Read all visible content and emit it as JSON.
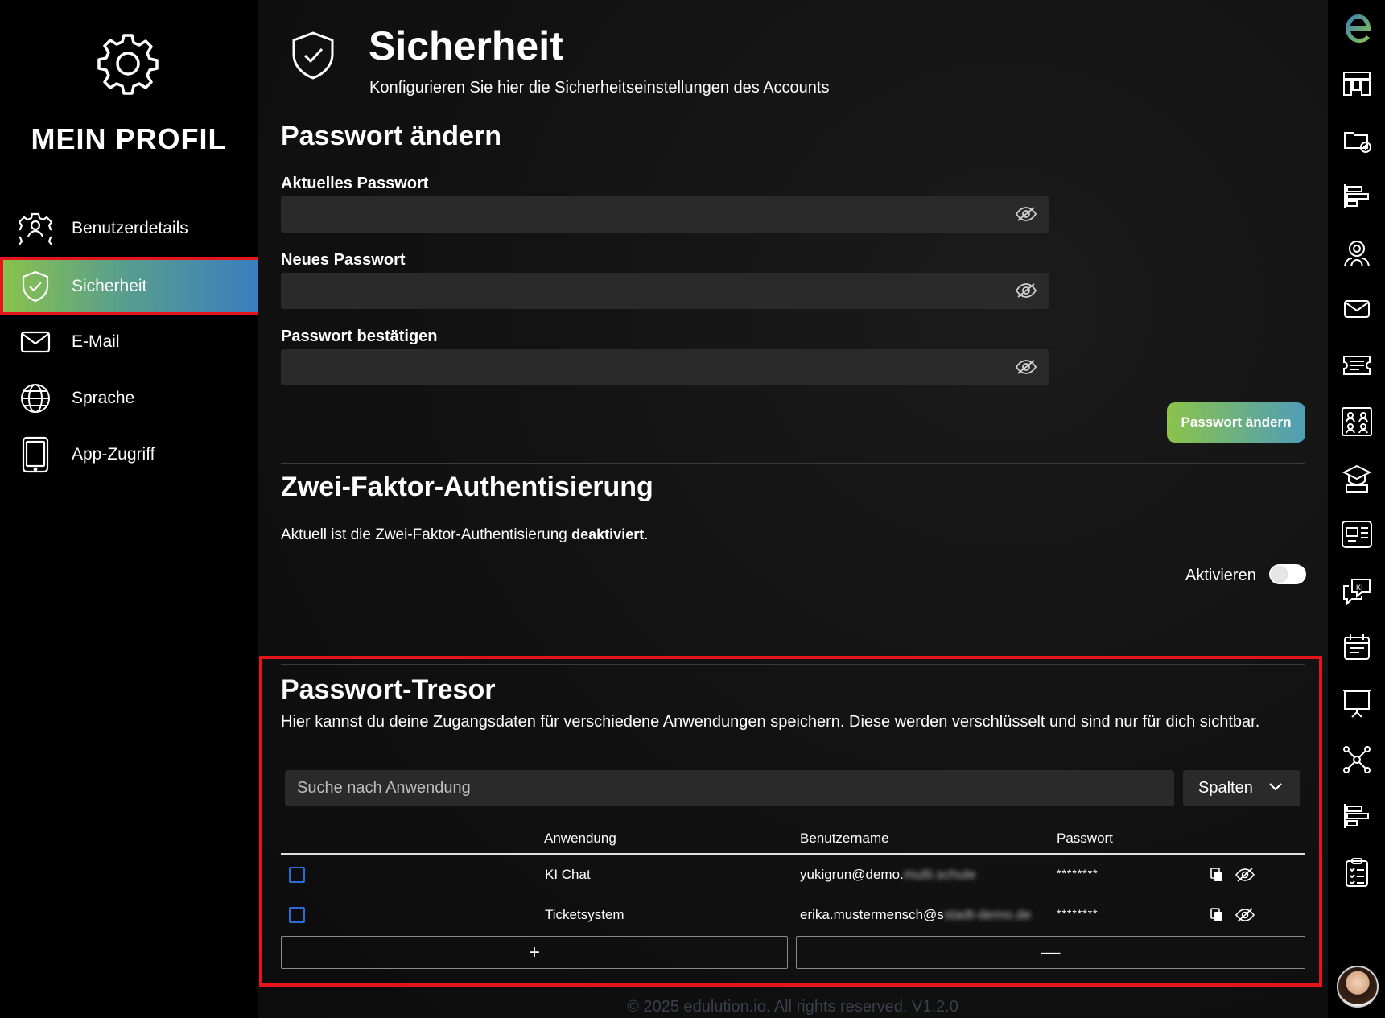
{
  "sidebar": {
    "title": "MEIN PROFIL",
    "items": [
      {
        "label": "Benutzerdetails",
        "icon": "user-gear-icon",
        "active": false
      },
      {
        "label": "Sicherheit",
        "icon": "shield-check-icon",
        "active": true
      },
      {
        "label": "E-Mail",
        "icon": "mail-icon",
        "active": false
      },
      {
        "label": "Sprache",
        "icon": "globe-icon",
        "active": false
      },
      {
        "label": "App-Zugriff",
        "icon": "tablet-icon",
        "active": false
      }
    ]
  },
  "header": {
    "title": "Sicherheit",
    "subtitle": "Konfigurieren Sie hier die Sicherheitseinstellungen des Accounts"
  },
  "password_change": {
    "heading": "Passwort ändern",
    "current_label": "Aktuelles Passwort",
    "new_label": "Neues Passwort",
    "confirm_label": "Passwort bestätigen",
    "submit_label": "Passwort ändern"
  },
  "two_factor": {
    "heading": "Zwei-Faktor-Authentisierung",
    "status_prefix": "Aktuell ist die Zwei-Faktor-Authentisierung",
    "status_value": "deaktiviert",
    "status_suffix": ".",
    "toggle_label": "Aktivieren",
    "enabled": false
  },
  "vault": {
    "heading": "Passwort-Tresor",
    "description": "Hier kannst du deine Zugangsdaten für verschiedene Anwendungen speichern. Diese werden verschlüsselt und sind nur für dich sichtbar.",
    "search_placeholder": "Suche nach Anwendung",
    "columns_button": "Spalten",
    "columns": [
      "Anwendung",
      "Benutzername",
      "Passwort"
    ],
    "rows": [
      {
        "application": "KI Chat",
        "username_visible": "yukigrun@demo.",
        "username_blurred": "multi.schule",
        "password": "********"
      },
      {
        "application": "Ticketsystem",
        "username_visible": "erika.mustermensch@s",
        "username_blurred": "stadt-demo.de",
        "password": "********"
      }
    ],
    "add_label": "+",
    "remove_label": "—"
  },
  "footer": "© 2025 edulution.io. All rights reserved. V1.2.0",
  "colors": {
    "accent_green": "#8bc34a",
    "accent_blue": "#3a7fbf",
    "highlight_red": "#e8141c",
    "checkbox_blue": "#2f6bd6"
  },
  "rail_icons": [
    "edulution-logo-icon",
    "kanban-icon",
    "cloud-share-icon",
    "gantt-icon",
    "group-settings-icon",
    "mail-icon",
    "ticket-icon",
    "classroom-icon",
    "learning-icon",
    "device-settings-icon",
    "ai-chat-icon",
    "calendar-icon",
    "presentation-icon",
    "network-icon",
    "gantt-icon",
    "checklist-icon",
    "user-avatar"
  ]
}
